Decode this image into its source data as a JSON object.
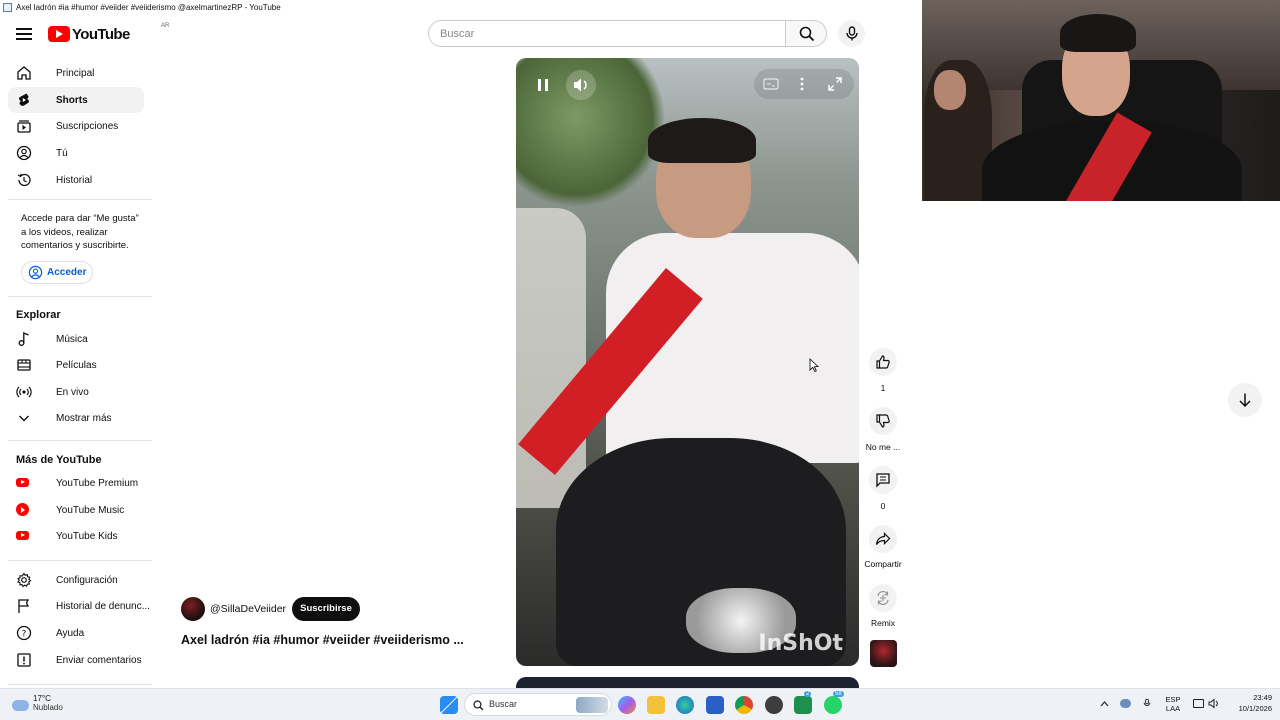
{
  "window": {
    "title": "Axel ladrón #ia #humor #veiider #veiiderismo @axelmartinezRP - YouTube"
  },
  "header": {
    "logo_text": "YouTube",
    "country_code": "AR",
    "search_placeholder": "Buscar"
  },
  "sidebar": {
    "main_items": [
      {
        "label": "Principal",
        "icon": "home-icon"
      },
      {
        "label": "Shorts",
        "icon": "shorts-icon",
        "active": true
      },
      {
        "label": "Suscripciones",
        "icon": "subscriptions-icon"
      },
      {
        "label": "Tú",
        "icon": "user-icon"
      },
      {
        "label": "Historial",
        "icon": "history-icon"
      }
    ],
    "signin_prompt": "Accede para dar “Me gusta” a los videos, realizar comentarios y suscribirte.",
    "signin_label": "Acceder",
    "explore_title": "Explorar",
    "explore_items": [
      {
        "label": "Música",
        "icon": "music-icon"
      },
      {
        "label": "Películas",
        "icon": "movies-icon"
      },
      {
        "label": "En vivo",
        "icon": "live-icon"
      },
      {
        "label": "Mostrar más",
        "icon": "chevron-down-icon"
      }
    ],
    "more_title": "Más de YouTube",
    "more_items": [
      {
        "label": "YouTube Premium",
        "icon": "youtube-premium-icon"
      },
      {
        "label": "YouTube Music",
        "icon": "youtube-music-icon"
      },
      {
        "label": "YouTube Kids",
        "icon": "youtube-kids-icon"
      }
    ],
    "footer_items": [
      {
        "label": "Configuración",
        "icon": "gear-icon"
      },
      {
        "label": "Historial de denunc...",
        "icon": "flag-icon"
      },
      {
        "label": "Ayuda",
        "icon": "help-icon"
      },
      {
        "label": "Enviar comentarios",
        "icon": "feedback-icon"
      }
    ]
  },
  "video": {
    "watermark": "InShOt",
    "channel": "@SillaDeVeiider",
    "subscribe_label": "Suscribirse",
    "title": "Axel ladrón #ia #humor #veiider #veiiderismo ..."
  },
  "actions": {
    "likes": "1",
    "dislike_label": "No me ...",
    "comments": "0",
    "share_label": "Compartir",
    "remix_label": "Remix"
  },
  "taskbar": {
    "temperature": "17°C",
    "weather": "Nublado",
    "search_label": "Buscar",
    "lang_top": "ESP",
    "lang_bottom": "LAA",
    "time": "23:49",
    "date": "10/1/2026",
    "badges": {
      "discord": "2",
      "whatsapp": "58"
    }
  },
  "colors": {
    "brand_red": "#ff0000",
    "link_blue": "#065fd4",
    "river_red": "#d21e25"
  }
}
